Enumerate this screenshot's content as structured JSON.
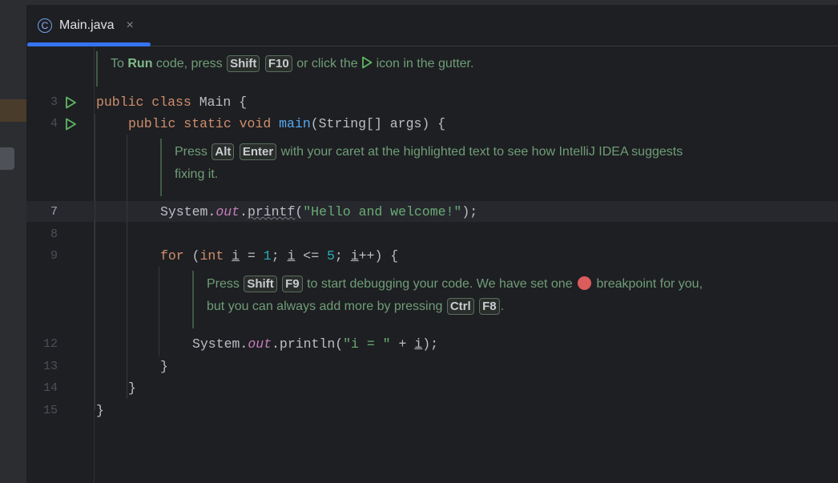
{
  "tab": {
    "icon": "java-class-icon",
    "label": "Main.java",
    "close": "×"
  },
  "hint_run": {
    "pre": "To",
    "bold": "Run",
    "mid": "code, press",
    "k1": "Shift",
    "k2": "F10",
    "post1": "or click the",
    "post2": "icon in the gutter."
  },
  "hint_fix": {
    "pre": "Press",
    "k1": "Alt",
    "k2": "Enter",
    "post": "with your caret at the highlighted text to see how IntelliJ IDEA suggests",
    "line2": "fixing it."
  },
  "hint_debug": {
    "pre": "Press",
    "k1": "Shift",
    "k2": "F9",
    "mid": "to start debugging your code. We have set one",
    "post": "breakpoint for you,",
    "line2pre": "but you can always add more by pressing",
    "k3": "Ctrl",
    "k4": "F8",
    "dot": "."
  },
  "line_numbers": {
    "l3": "3",
    "l4": "4",
    "l7": "7",
    "l8": "8",
    "l9": "9",
    "l12": "12",
    "l13": "13",
    "l14": "14",
    "l15": "15"
  },
  "code": {
    "l3": {
      "kw": "public class",
      "name": " Main {"
    },
    "l4": {
      "kw": "public static void",
      "fn": "main",
      "rest": "(String[] args) {"
    },
    "l7": {
      "a": "System.",
      "fld": "out",
      "b": ".",
      "fn": "printf",
      "c": "(",
      "str": "\"Hello and welcome!\"",
      "d": ");"
    },
    "l9": {
      "kw1": "for",
      "a": " (",
      "kw2": "int",
      "sp": " ",
      "v1": "i",
      "b": " = ",
      "n1": "1",
      "c": "; ",
      "v2": "i",
      "d": " <= ",
      "n2": "5",
      "e": "; ",
      "v3": "i",
      "f": "++) {"
    },
    "l12": {
      "a": "System.",
      "fld": "out",
      "b": ".println(",
      "str": "\"i = \"",
      "c": " + ",
      "v": "i",
      "d": ");"
    },
    "l13": "}",
    "l14": "}",
    "l15": "}"
  }
}
